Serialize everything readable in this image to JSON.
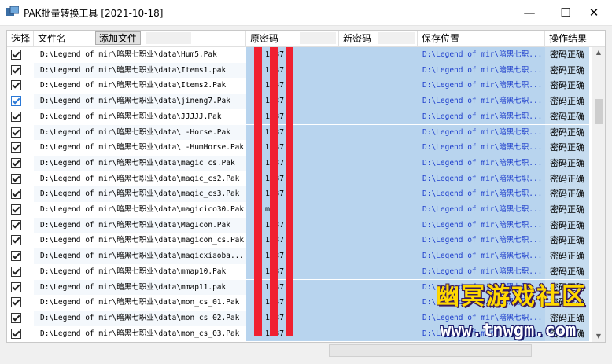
{
  "window": {
    "title": "PAK批量转换工具 [2021-10-18]",
    "min": "—",
    "max": "☐",
    "close": "✕"
  },
  "columns": {
    "select": "选择",
    "filename": "文件名",
    "add_button": "添加文件",
    "old_password": "原密码",
    "new_password": "新密码",
    "save_location": "保存位置",
    "result": "操作结果"
  },
  "rows": [
    {
      "file": "D:\\Legend of mir\\暗黑七职业\\data\\Hum5.Pak",
      "old": "1 1 87 2",
      "path": "D:\\Legend of mir\\暗黑七职...",
      "result": "密码正确",
      "checked_style": "normal"
    },
    {
      "file": "D:\\Legend of mir\\暗黑七职业\\data\\Items1.pak",
      "old": "1 1 87 2",
      "path": "D:\\Legend of mir\\暗黑七职...",
      "result": "密码正确",
      "checked_style": "normal"
    },
    {
      "file": "D:\\Legend of mir\\暗黑七职业\\data\\Items2.Pak",
      "old": "1 1 87 2",
      "path": "D:\\Legend of mir\\暗黑七职...",
      "result": "密码正确",
      "checked_style": "normal"
    },
    {
      "file": "D:\\Legend of mir\\暗黑七职业\\data\\jineng7.Pak",
      "old": "1 1 87 2",
      "path": "D:\\Legend of mir\\暗黑七职...",
      "result": "密码正确",
      "checked_style": "blue"
    },
    {
      "file": "D:\\Legend of mir\\暗黑七职业\\data\\JJJJJ.Pak",
      "old": "1 1 87 2",
      "path": "D:\\Legend of mir\\暗黑七职...",
      "result": "密码正确",
      "checked_style": "normal"
    },
    {
      "file": "D:\\Legend of mir\\暗黑七职业\\data\\L-Horse.Pak",
      "old": "1 1 87 2",
      "path": "D:\\Legend of mir\\暗黑七职...",
      "result": "密码正确",
      "checked_style": "normal"
    },
    {
      "file": "D:\\Legend of mir\\暗黑七职业\\data\\L-HumHorse.Pak",
      "old": "1 1 87 2",
      "path": "D:\\Legend of mir\\暗黑七职...",
      "result": "密码正确",
      "checked_style": "normal"
    },
    {
      "file": "D:\\Legend of mir\\暗黑七职业\\data\\magic_cs.Pak",
      "old": "1 1 87 2",
      "path": "D:\\Legend of mir\\暗黑七职...",
      "result": "密码正确",
      "checked_style": "normal"
    },
    {
      "file": "D:\\Legend of mir\\暗黑七职业\\data\\magic_cs2.Pak",
      "old": "1 1 87 2",
      "path": "D:\\Legend of mir\\暗黑七职...",
      "result": "密码正确",
      "checked_style": "normal"
    },
    {
      "file": "D:\\Legend of mir\\暗黑七职业\\data\\magic_cs3.Pak",
      "old": "1 1 87 2",
      "path": "D:\\Legend of mir\\暗黑七职...",
      "result": "密码正确",
      "checked_style": "normal"
    },
    {
      "file": "D:\\Legend of mir\\暗黑七职业\\data\\magicico30.Pak",
      "old": "e m",
      "path": "D:\\Legend of mir\\暗黑七职...",
      "result": "密码正确",
      "checked_style": "normal"
    },
    {
      "file": "D:\\Legend of mir\\暗黑七职业\\data\\MagIcon.Pak",
      "old": "1 1 87 2",
      "path": "D:\\Legend of mir\\暗黑七职...",
      "result": "密码正确",
      "checked_style": "normal"
    },
    {
      "file": "D:\\Legend of mir\\暗黑七职业\\data\\magicon_cs.Pak",
      "old": "1 1 87 2",
      "path": "D:\\Legend of mir\\暗黑七职...",
      "result": "密码正确",
      "checked_style": "normal"
    },
    {
      "file": "D:\\Legend of mir\\暗黑七职业\\data\\magicxiaoba...",
      "old": "1 1 87 2",
      "path": "D:\\Legend of mir\\暗黑七职...",
      "result": "密码正确",
      "checked_style": "normal"
    },
    {
      "file": "D:\\Legend of mir\\暗黑七职业\\data\\mmap10.Pak",
      "old": "1 1 87 2",
      "path": "D:\\Legend of mir\\暗黑七职...",
      "result": "密码正确",
      "checked_style": "normal"
    },
    {
      "file": "D:\\Legend of mir\\暗黑七职业\\data\\mmap11.pak",
      "old": "1 1 87 2",
      "path": "D:\\Legend of mir\\暗黑七职...",
      "result": "密码正确",
      "checked_style": "normal"
    },
    {
      "file": "D:\\Legend of mir\\暗黑七职业\\data\\mon_cs_01.Pak",
      "old": "1 1 87 2",
      "path": "D:\\Legend of mir\\暗黑七职...",
      "result": "密码正确",
      "checked_style": "normal"
    },
    {
      "file": "D:\\Legend of mir\\暗黑七职业\\data\\mon_cs_02.Pak",
      "old": "1 1 87 2",
      "path": "D:\\Legend of mir\\暗黑七职...",
      "result": "密码正确",
      "checked_style": "normal"
    },
    {
      "file": "D:\\Legend of mir\\暗黑七职业\\data\\mon_cs_03.Pak",
      "old": "1 1 87 2",
      "path": "D:\\Legend of mir\\暗黑七职...",
      "result": "密码正确",
      "checked_style": "normal"
    }
  ],
  "watermark": {
    "title": "幽冥游戏社区",
    "url": "www.tnwgm.com"
  },
  "colors": {
    "highlight": "#b8d4ee",
    "redaction": "#f02030",
    "path_text": "#1f3fcc"
  }
}
